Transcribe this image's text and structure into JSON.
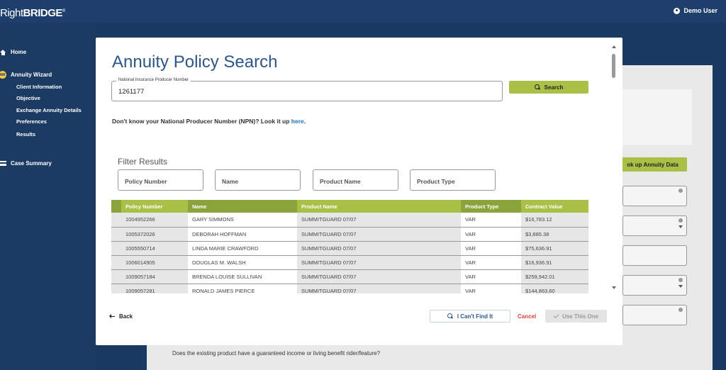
{
  "header": {
    "logo_thin": "Right",
    "logo_bold": "BRIDGE",
    "logo_mark": "®",
    "user_name": "Demo User"
  },
  "sidebar": {
    "home": "Home",
    "annuity_wizard": "Annuity Wizard",
    "annuity_wizard_icon": "AW",
    "sub_items": [
      "Client Information",
      "Objective",
      "Exchange Annuity Details",
      "Preferences",
      "Results"
    ],
    "case_summary": "Case Summary"
  },
  "background": {
    "lookup_button": "ok up Annuity Data",
    "question": "Does the existing product have a guaranteed income or living benefit rider/feature?"
  },
  "modal": {
    "title": "Annuity Policy Search",
    "npn_label": "National Insurance Producer Number",
    "npn_value": "1261177",
    "search_label": "Search",
    "lookup_text": "Don't know your National Producer Number (NPN)? Look it up",
    "lookup_link": "here",
    "lookup_period": ".",
    "filter_title": "Filter Results",
    "filters": {
      "policy_number": "Policy Number",
      "name": "Name",
      "product_name": "Product Name",
      "product_type": "Product Type"
    },
    "table": {
      "headers": [
        "Policy Number",
        "Name",
        "Product Name",
        "Product Type",
        "Contract Value"
      ],
      "rows": [
        [
          "1004952266",
          "GARY SIMMONS",
          "SUMMITGUARD 07/07",
          "VAR",
          "$16,783.12"
        ],
        [
          "1005372026",
          "DEBORAH HOFFMAN",
          "SUMMITGUARD 07/07",
          "VAR",
          "$3,885.38"
        ],
        [
          "1005550714",
          "LINDA MARIE CRAWFORD",
          "SUMMITGUARD 07/07",
          "VAR",
          "$75,636.91"
        ],
        [
          "1006014905",
          "DOUGLAS M. WALSH",
          "SUMMITGUARD 07/07",
          "VAR",
          "$16,936.91"
        ],
        [
          "1009057184",
          "BRENDA LOUISE SULLIVAN",
          "SUMMITGUARD 07/07",
          "VAR",
          "$259,942.01"
        ],
        [
          "1009057281",
          "RONALD JAMES PIERCE",
          "SUMMITGUARD 07/07",
          "VAR",
          "$144,863.60"
        ]
      ]
    },
    "back_label": "Back",
    "cant_find_label": "I Can't Find It",
    "cancel_label": "Cancel",
    "use_label": "Use This One"
  },
  "colors": {
    "accent_green": "#a9c046",
    "header_green": "#8aa33b",
    "navy": "#1c3b62",
    "title_blue": "#2d5688",
    "cancel_red": "#d9433a",
    "link_blue": "#1a73c9"
  }
}
